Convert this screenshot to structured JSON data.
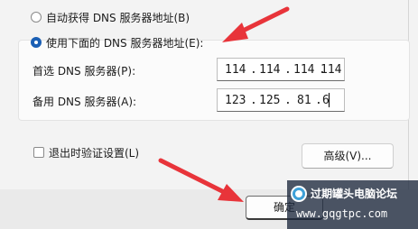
{
  "dns_options": {
    "auto_label": "自动获得 DNS 服务器地址(B)",
    "manual_label": "使用下面的 DNS 服务器地址(E):"
  },
  "preferred_dns": {
    "label": "首选 DNS 服务器(P):",
    "octets": [
      "114",
      "114",
      "114",
      "114"
    ]
  },
  "alternate_dns": {
    "label": "备用 DNS 服务器(A):",
    "octets": [
      "123",
      "125",
      "81",
      "6"
    ]
  },
  "validate_on_exit": {
    "label": "退出时验证设置(L)"
  },
  "buttons": {
    "advanced": "高级(V)...",
    "ok": "确定"
  },
  "watermark": {
    "title": "过期罐头电脑论坛",
    "url": "www.gqgtpc.com"
  },
  "colors": {
    "arrow": "#e8343a",
    "accent": "#1a5fb4"
  }
}
